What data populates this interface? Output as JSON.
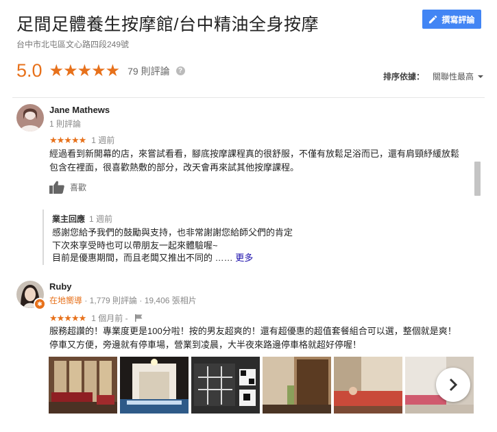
{
  "place": {
    "title": "足間足體養生按摩館/台中精油全身按摩",
    "address": "台中市北屯區文心路四段249號",
    "write_review_label": "撰寫評論",
    "rating": "5.0",
    "stars": "★★★★★",
    "review_count": "79 則評論",
    "help_icon": "?"
  },
  "sort": {
    "label": "排序依據：",
    "value": "關聯性最高"
  },
  "reviews": [
    {
      "author": "Jane Mathews",
      "author_meta": "1 則評論",
      "stars": "★★★★★",
      "time": "1 週前",
      "text_line1": "經過看到新開幕的店，來嘗試看看，腳底按摩課程真的很舒服，不僅有放鬆足浴而已，還有肩頸紓緩放鬆",
      "text_line2": "包含在裡面，很喜歡熱敷的部分，改天會再來試其他按摩課程。",
      "like_label": "喜歡",
      "reply": {
        "label": "業主回應",
        "time": "1 週前",
        "line1": "感謝您給予我們的鼓勵與支持，也非常謝謝您給師父們的肯定",
        "line2": "下次來享受時也可以帶朋友一起來體驗喔~",
        "line3": "目前是優惠期間，而且老闆又推出不同的 ……",
        "more_label": "更多"
      }
    },
    {
      "author": "Ruby",
      "guide_label": "在地嚮導",
      "author_meta": " · 1,779 則評論 · 19,406 張相片",
      "stars": "★★★★★",
      "time": "1 個月前 -",
      "text_line1": "服務超讚的！專業度更是100分啦！按的男友超爽的！還有超優惠的超值套餐組合可以選，整個就是爽！",
      "text_line2": "停車又方便，旁邊就有停車場，營業到凌晨，大半夜來路邊停車格就超好停喔！"
    }
  ],
  "icons": {
    "write": "pencil-icon",
    "like": "thumbs-up-icon",
    "flag": "flag-icon",
    "next": "chevron-right-icon",
    "help": "help-icon"
  },
  "colors": {
    "accent": "#e7711b",
    "button": "#4285f4",
    "link": "#1a0dab"
  }
}
